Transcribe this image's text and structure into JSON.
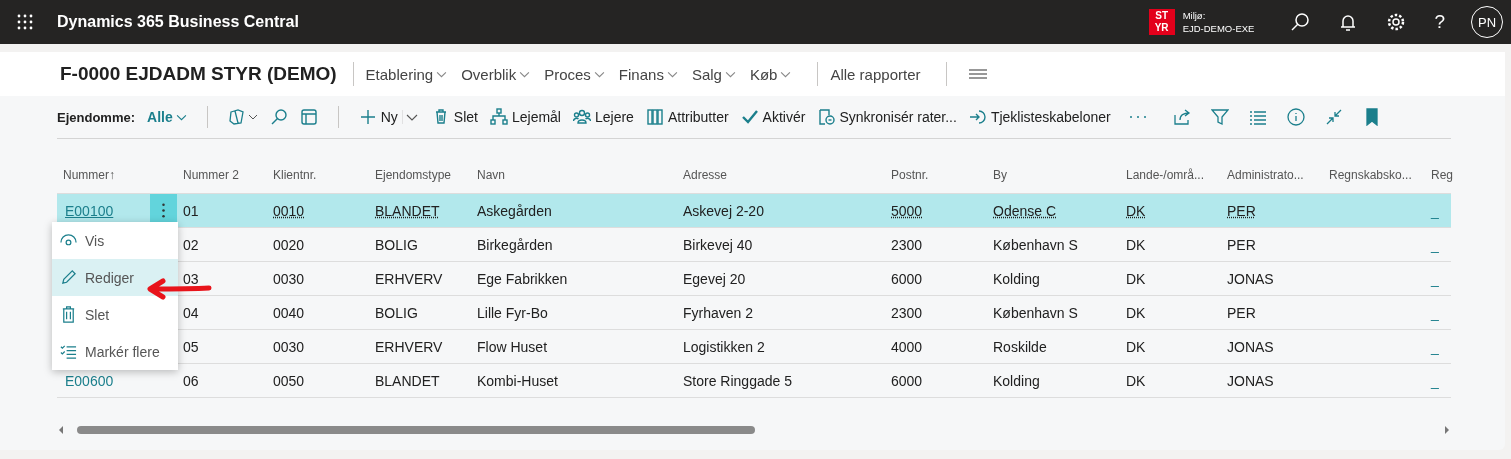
{
  "topbar": {
    "app_title": "Dynamics 365 Business Central",
    "env_badge": "ST YR",
    "env_label": "Miljø:",
    "env_name": "EJD-DEMO-EXE",
    "help": "?",
    "avatar": "PN"
  },
  "page": {
    "title": "F-0000 EJDADM STYR (DEMO)",
    "nav": [
      "Etablering",
      "Overblik",
      "Proces",
      "Finans",
      "Salg",
      "Køb"
    ],
    "reports": "Alle rapporter"
  },
  "toolbar": {
    "filter_label": "Ejendomme:",
    "filter_value": "Alle",
    "new": "Ny",
    "actions": [
      "Slet",
      "Lejemål",
      "Lejere",
      "Attributter",
      "Aktivér",
      "Synkronisér rater...",
      "Tjeklisteskabeloner"
    ]
  },
  "table": {
    "columns": [
      {
        "label": "Nummer",
        "sort_indicator": "↑"
      },
      {
        "label": "Nummer 2"
      },
      {
        "label": "Klientnr.",
        "lookup": true
      },
      {
        "label": "Ejendomstype",
        "lookup": true
      },
      {
        "label": "Navn"
      },
      {
        "label": "Adresse"
      },
      {
        "label": "Postnr.",
        "lookup": true
      },
      {
        "label": "By",
        "lookup": true
      },
      {
        "label": "Lande-/områ...",
        "lookup": true
      },
      {
        "label": "Administrato...",
        "lookup": true
      },
      {
        "label": "Regnskabsko..."
      },
      {
        "label": "Reg"
      }
    ],
    "rows": [
      {
        "selected": true,
        "cells": [
          "E00100",
          "01",
          "0010",
          "BLANDET",
          "Askegården",
          "Askevej 2-20",
          "5000",
          "Odense C",
          "DK",
          "PER",
          "",
          "_"
        ]
      },
      {
        "selected": false,
        "cells": [
          "",
          "02",
          "0020",
          "BOLIG",
          "Birkegården",
          "Birkevej 40",
          "2300",
          "København S",
          "DK",
          "PER",
          "",
          "_"
        ]
      },
      {
        "selected": false,
        "cells": [
          "",
          "03",
          "0030",
          "ERHVERV",
          "Ege Fabrikken",
          "Egevej 20",
          "6000",
          "Kolding",
          "DK",
          "JONAS",
          "",
          "_"
        ]
      },
      {
        "selected": false,
        "cells": [
          "",
          "04",
          "0040",
          "BOLIG",
          "Lille Fyr-Bo",
          "Fyrhaven 2",
          "2300",
          "København S",
          "DK",
          "PER",
          "",
          "_"
        ]
      },
      {
        "selected": false,
        "cells": [
          "",
          "05",
          "0030",
          "ERHVERV",
          "Flow Huset",
          "Logistikken 2",
          "4000",
          "Roskilde",
          "DK",
          "JONAS",
          "",
          "_"
        ]
      },
      {
        "selected": false,
        "cells": [
          "E00600",
          "06",
          "0050",
          "BLANDET",
          "Kombi-Huset",
          "Store Ringgade 5",
          "6000",
          "Kolding",
          "DK",
          "JONAS",
          "",
          "_"
        ]
      }
    ]
  },
  "context_menu": [
    {
      "label": "Vis",
      "selected": false
    },
    {
      "label": "Rediger",
      "selected": true
    },
    {
      "label": "Slet",
      "selected": false
    },
    {
      "label": "Markér flere",
      "selected": false
    }
  ]
}
